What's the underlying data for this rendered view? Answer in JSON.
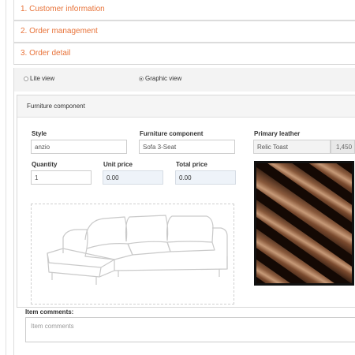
{
  "accordion": {
    "section1": "1. Customer information",
    "section2": "2. Order management",
    "section3": "3. Order detail"
  },
  "view_toggle": {
    "lite_label": "Lite view",
    "graphic_label": "Graphic view",
    "selected": "Graphic view"
  },
  "panel": {
    "title": "Furniture component"
  },
  "form": {
    "style": {
      "label": "Style",
      "value": "anzio"
    },
    "component": {
      "label": "Furniture component",
      "value": "Sofa 3-Seat"
    },
    "leather": {
      "label": "Primary leather",
      "value": "Relic Toast",
      "addon": "1,450"
    },
    "quantity": {
      "label": "Quantity",
      "value": "1"
    },
    "unit_price": {
      "label": "Unit price",
      "value": "0.00"
    },
    "total_price": {
      "label": "Total price",
      "value": "0.00"
    }
  },
  "comments": {
    "label": "Item comments:",
    "placeholder": "Item comments"
  },
  "colors": {
    "accent": "#e8743b",
    "readonly_bg": "#eef3f9"
  }
}
